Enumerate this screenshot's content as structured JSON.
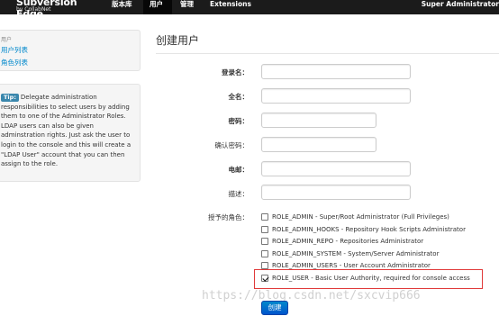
{
  "navbar": {
    "brand": "Subversion Edge",
    "brand_sub": "by CollabNet",
    "items": [
      {
        "label": "版本库"
      },
      {
        "label": "用户"
      },
      {
        "label": "管理"
      },
      {
        "label": "Extensions"
      }
    ],
    "active_index": 1,
    "user": "Super Administrator"
  },
  "sidebar": {
    "header": "用户",
    "links": [
      {
        "label": "用户列表"
      },
      {
        "label": "角色列表"
      }
    ]
  },
  "tip": {
    "badge": "Tip:",
    "text": "Delegate administration responsibilities to select users by adding them to one of the Administrator Roles. LDAP users can also be given adminstration rights. Just ask the user to login to the console and this will create a \"LDAP User\" account that you can then assign to the role."
  },
  "form": {
    "title": "创建用户",
    "fields": [
      {
        "label": "登录名：",
        "value": ""
      },
      {
        "label": "全名：",
        "value": ""
      },
      {
        "label": "密码：",
        "value": ""
      },
      {
        "label": "确认密码：",
        "value": ""
      },
      {
        "label": "电邮：",
        "value": ""
      },
      {
        "label": "描述：",
        "value": ""
      }
    ],
    "roles_label": "授予的角色：",
    "roles": [
      {
        "label": "ROLE_ADMIN - Super/Root Administrator (Full Privileges)",
        "checked": false
      },
      {
        "label": "ROLE_ADMIN_HOOKS - Repository Hook Scripts Administrator",
        "checked": false
      },
      {
        "label": "ROLE_ADMIN_REPO - Repositories Administrator",
        "checked": false
      },
      {
        "label": "ROLE_ADMIN_SYSTEM - System/Server Administrator",
        "checked": false
      },
      {
        "label": "ROLE_ADMIN_USERS - User Account Administrator",
        "checked": false
      },
      {
        "label": "ROLE_USER - Basic User Authority, required for console access",
        "checked": true
      }
    ],
    "submit_label": "创建"
  },
  "watermark": "https://blog.csdn.net/sxcvip666",
  "colors": {
    "navbar_bg": "#1b1b1b",
    "link": "#0088cc",
    "tip_badge": "#3a87ad",
    "button": "#0074cc",
    "highlight_border": "#e03a3a"
  }
}
